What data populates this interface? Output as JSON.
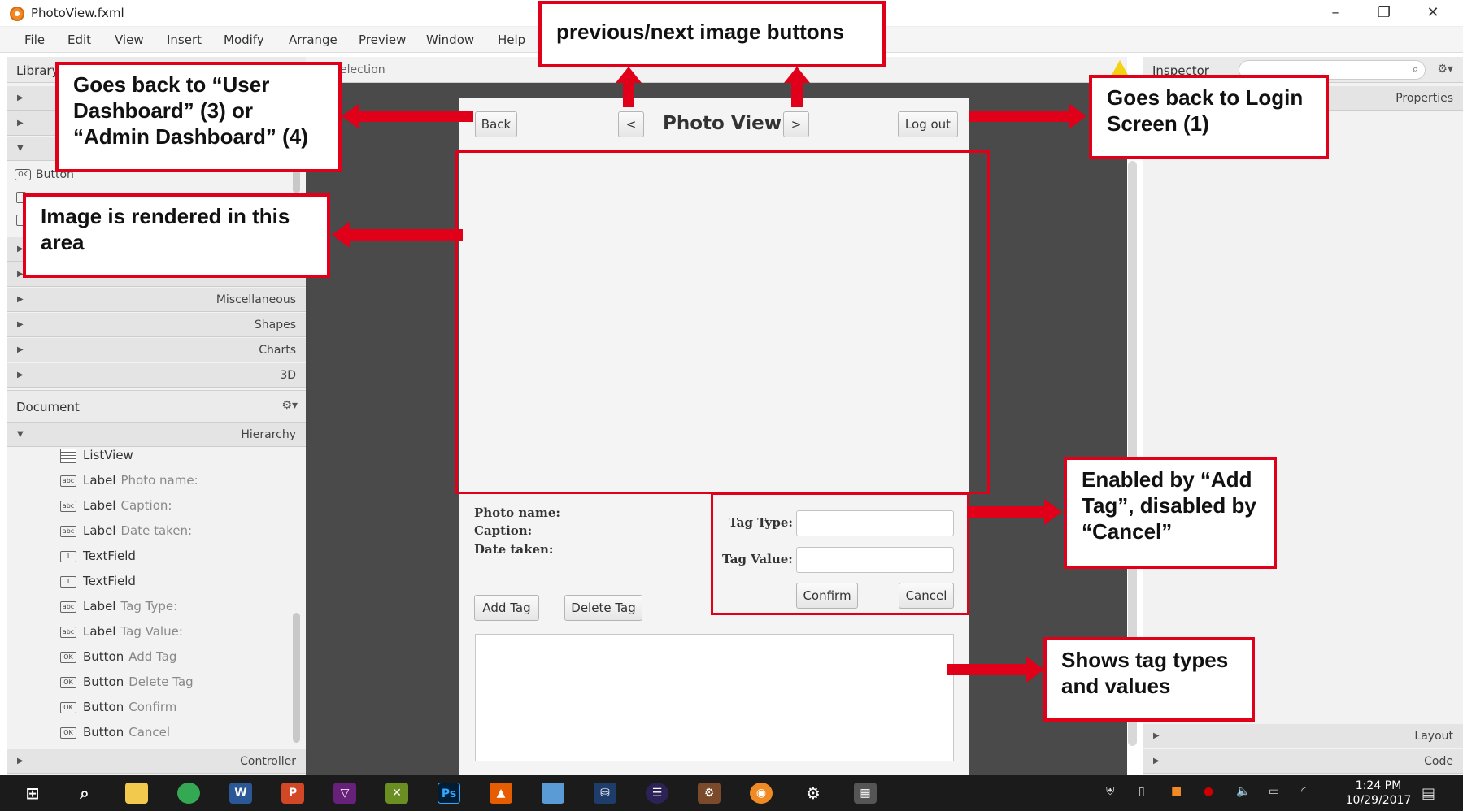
{
  "window": {
    "title": "PhotoView.fxml",
    "minimize": "–",
    "restore": "❐",
    "close": "✕"
  },
  "menu": [
    "File",
    "Edit",
    "View",
    "Insert",
    "Modify",
    "Arrange",
    "Preview",
    "Window",
    "Help"
  ],
  "library": {
    "title": "Library",
    "button_item": "Button",
    "sections": [
      "Miscellaneous",
      "Shapes",
      "Charts",
      "3D"
    ]
  },
  "document": {
    "title": "Document",
    "hierarchy_label": "Hierarchy",
    "controller_label": "Controller",
    "tree": [
      {
        "type": "ListView",
        "value": "",
        "icon": "listview-icon"
      },
      {
        "type": "Label",
        "value": "Photo name:",
        "icon": "label-icon"
      },
      {
        "type": "Label",
        "value": "Caption:",
        "icon": "label-icon"
      },
      {
        "type": "Label",
        "value": "Date taken:",
        "icon": "label-icon"
      },
      {
        "type": "TextField",
        "value": "",
        "icon": "textfield-icon"
      },
      {
        "type": "TextField",
        "value": "",
        "icon": "textfield-icon"
      },
      {
        "type": "Label",
        "value": "Tag Type:",
        "icon": "label-icon"
      },
      {
        "type": "Label",
        "value": "Tag Value:",
        "icon": "label-icon"
      },
      {
        "type": "Button",
        "value": "Add Tag",
        "icon": "button-icon"
      },
      {
        "type": "Button",
        "value": "Delete Tag",
        "icon": "button-icon"
      },
      {
        "type": "Button",
        "value": "Confirm",
        "icon": "button-icon"
      },
      {
        "type": "Button",
        "value": "Cancel",
        "icon": "button-icon"
      }
    ]
  },
  "canvas": {
    "selection_text": "election"
  },
  "photo_view": {
    "title": "Photo View",
    "back": "Back",
    "prev": "<",
    "next": ">",
    "logout": "Log out",
    "photo_name_label": "Photo name:",
    "caption_label": "Caption:",
    "date_taken_label": "Date taken:",
    "add_tag": "Add Tag",
    "delete_tag": "Delete Tag",
    "tag_type_label": "Tag Type:",
    "tag_value_label": "Tag Value:",
    "confirm": "Confirm",
    "cancel": "Cancel"
  },
  "inspector": {
    "title": "Inspector",
    "properties": "Properties",
    "layout": "Layout",
    "code": "Code"
  },
  "annotations": {
    "nav_buttons": "previous/next image buttons",
    "back": "Goes back to “User Dashboard” (3) or “Admin Dashboard” (4)",
    "image_area": "Image is rendered in this area",
    "logout": "Goes back to Login Screen (1)",
    "tag_form": "Enabled by “Add Tag”, disabled by “Cancel”",
    "tag_list": "Shows tag types and values"
  },
  "taskbar": {
    "time": "1:24 PM",
    "date": "10/29/2017"
  },
  "colors": {
    "annotation_red": "#e0001a",
    "canvas_gray": "#4a4a4a",
    "panel_bg": "#f2f2f2"
  }
}
